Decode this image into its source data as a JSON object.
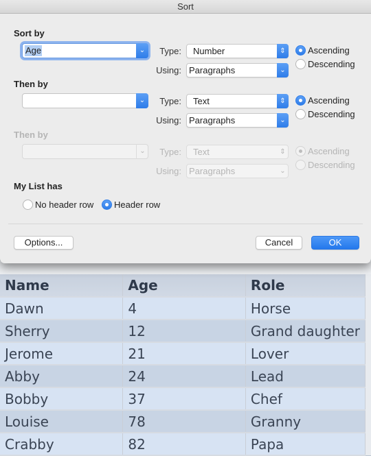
{
  "dialog": {
    "title": "Sort",
    "sort_by": {
      "label": "Sort by",
      "column": "Age",
      "type_label": "Type:",
      "type": "Number",
      "using_label": "Using:",
      "using": "Paragraphs",
      "ascending_label": "Ascending",
      "descending_label": "Descending",
      "order": "ascending"
    },
    "then_by_1": {
      "label": "Then by",
      "column": "",
      "type_label": "Type:",
      "type": "Text",
      "using_label": "Using:",
      "using": "Paragraphs",
      "ascending_label": "Ascending",
      "descending_label": "Descending",
      "order": "ascending"
    },
    "then_by_2": {
      "label": "Then by",
      "column": "",
      "type_label": "Type:",
      "type": "Text",
      "using_label": "Using:",
      "using": "Paragraphs",
      "ascending_label": "Ascending",
      "descending_label": "Descending",
      "order": "ascending",
      "enabled": false
    },
    "my_list_has": {
      "label": "My List has",
      "no_header_label": "No header row",
      "header_label": "Header row",
      "selected": "header"
    },
    "buttons": {
      "options": "Options...",
      "cancel": "Cancel",
      "ok": "OK"
    },
    "accent_color": "#2f7de9"
  },
  "table": {
    "headers": [
      "Name",
      "Age",
      "Role"
    ],
    "rows": [
      [
        "Dawn",
        "4",
        "Horse"
      ],
      [
        "Sherry",
        "12",
        "Grand daughter"
      ],
      [
        "Jerome",
        "21",
        "Lover"
      ],
      [
        "Abby",
        "24",
        "Lead"
      ],
      [
        "Bobby",
        "37",
        "Chef"
      ],
      [
        "Louise",
        "78",
        "Granny"
      ],
      [
        "Crabby",
        "82",
        "Papa"
      ]
    ]
  },
  "icons": {
    "chevron_down": "⌄",
    "updown": "⇕"
  }
}
